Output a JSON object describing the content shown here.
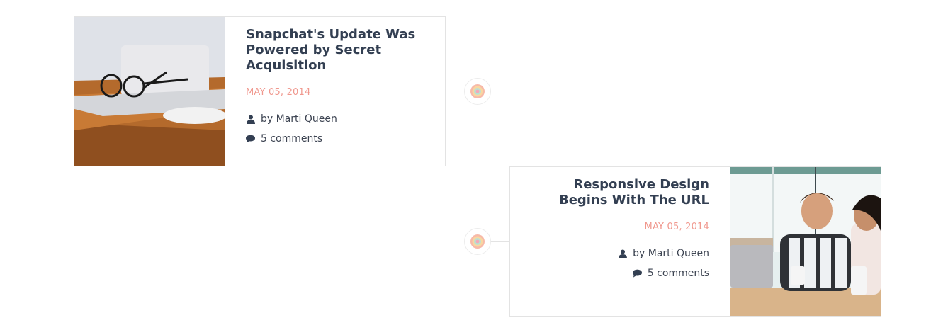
{
  "timeline": {
    "posts": [
      {
        "title": "Snapchat's Update Was Powered by Secret Acquisition",
        "date": "MAY 05, 2014",
        "author": "by Marti Queen",
        "comments": "5 comments",
        "side": "left",
        "icon": "spiral-icon"
      },
      {
        "title": "Responsive Design Begins With The URL",
        "date": "MAY 05, 2014",
        "author": "by Marti Queen",
        "comments": "5 comments",
        "side": "right",
        "icon": "spiral-icon"
      }
    ]
  },
  "colors": {
    "title": "#333f52",
    "date": "#f0988e",
    "meta": "#3d4452",
    "border": "#e3e3e3"
  }
}
